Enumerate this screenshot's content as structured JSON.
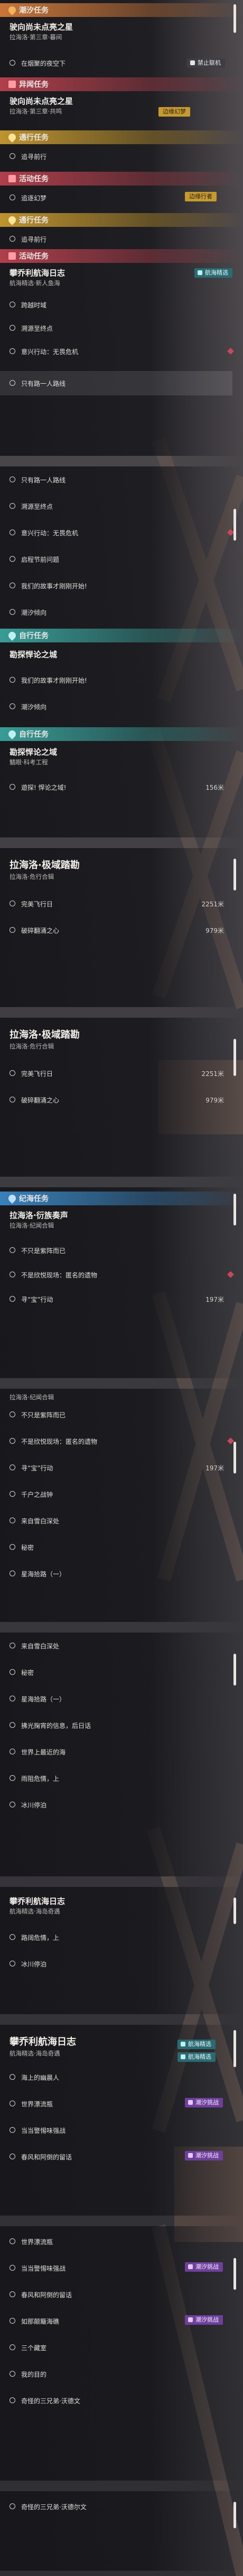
{
  "colors": {
    "orange": "#d07a3a",
    "red": "#b8414e",
    "gold": "#c79a2f",
    "teal": "#3aa39d",
    "blue": "#3a86c3",
    "purple": "#6e3f9b"
  },
  "categories": {
    "chaoxi": "潮汐任务",
    "yixiang": "异闻任务",
    "tonghang": "通行任务",
    "huodong": "活动任务",
    "ziyou": "自行任务",
    "jiyi": "纪海任务"
  },
  "badges": {
    "no_online": "禁止联机",
    "frontier_dream": "边缘幻梦",
    "frontier_walker": "边缘行者",
    "sea_deepen": "航海精选",
    "tide": "潮汐挑战"
  },
  "quests": {
    "zero_star_1": {
      "title": "驶向尚未点亮之星",
      "sub": "拉海洛·第三章·暮间"
    },
    "zero_star_2": {
      "title": "驶向尚未点亮之星",
      "sub": "拉海洛·第三章·共鸣"
    },
    "chase_dream": {
      "title": "追逐幻梦"
    },
    "chaser": {
      "title": "追寻前行"
    },
    "log_1": {
      "title": "攀乔利航海日志",
      "sub": "航海精选·新人鱼海"
    },
    "rogue_1": {
      "title": "勘探悍论之城"
    },
    "rogue_2": {
      "title": "勘探悍论之域",
      "sub": "魑眼·科考工程"
    },
    "port_1": {
      "title": "拉海洛·极域踏勘",
      "sub": "拉海洛·危行合辑"
    },
    "port_2": {
      "title": "拉海洛·极域踏勘",
      "sub": "拉海洛·危行合辑"
    },
    "voyage": {
      "title": "拉海洛·衍族奏声",
      "sub": "拉海洛·纪闻合辑"
    },
    "voyage_2": {
      "sub": "拉海洛·纪闻合辑"
    },
    "log_2": {
      "title": "攀乔利航海日志",
      "sub": "航海精选·海岛奇遇"
    },
    "log_3": {
      "title": "攀乔利航海日志",
      "sub": "航海精选·海岛奇遇"
    }
  },
  "objectives": {
    "a1": "在烟聚的夜空下",
    "a2": "跨越时域",
    "a3": "只有路一人路线",
    "b1": "只有路一人路线",
    "b2": "溯源至终点",
    "b3": "意兴行动：无畏危机",
    "c1": "只有路一人路线",
    "c2": "溯源至终点",
    "c3": "意兴行动：无畏危机",
    "c4": "启程节前问题",
    "c5": "我们的故事才刚刚开始!",
    "c6": "潮汐倾向",
    "d1": "我们的故事才刚刚开始!",
    "d2": "潮汐倾向",
    "e1": "遊探! 悍论之域!",
    "e1d": "156米",
    "f1": "完美飞行日",
    "f1d": "2251米",
    "f2": "破碎翻涌之心",
    "f2d": "979米",
    "g1": "完美飞行日",
    "g1d": "2251米",
    "g2": "破碎翻涌之心",
    "g2d": "979米",
    "h1": "不只是紫阵而已",
    "h2": "不是欣悦现场：匿名的遗物",
    "h3": "寻“宝”行动",
    "h3d": "197米",
    "i1": "不只是紫阵而已",
    "i2": "不是欣悦现场：匿名的遗物",
    "i3": "寻“宝”行动",
    "i3d": "197米",
    "i4": "千户之战钟",
    "i5": "来自雪白深处",
    "i6": "秘密",
    "i7": "星海拾路（一）",
    "j1": "来自雪白深处",
    "j2": "秘密",
    "j3": "星海拾路（一）",
    "j4": "拂光掬宵的信息，后日话",
    "j5": "世界上最近的海",
    "j6": "雨阻危情，上",
    "j7": "冰川停泊",
    "k1": "路阔危情，上",
    "k2": "冰川停泊",
    "l1": "海上的幽晨人",
    "l2": "世界漂流瓶",
    "l3": "当当警惕味强战",
    "l4": "春风和阿倒的留话",
    "m1": "世界漂流瓶",
    "m2": "当当警惕味强战",
    "m3": "春风和阿倒的留话",
    "m4": "如那颠簸海礁",
    "m5": "三个藏室",
    "m6": "我的目的",
    "m7": "奇怪的三兄弟·沃德文",
    "n1": "奇怪的三兄弟·沃德尔文"
  }
}
